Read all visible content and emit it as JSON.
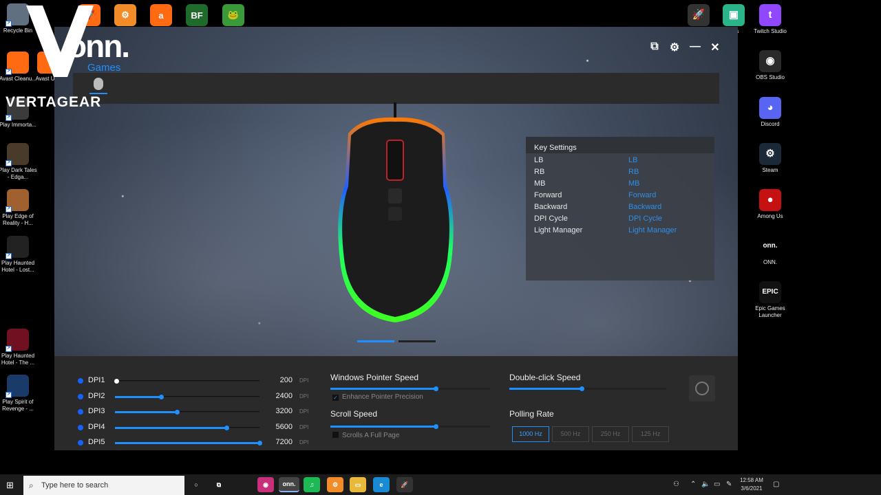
{
  "desktop": {
    "left_icons": [
      {
        "label": "Recycle Bin",
        "icon": "recycle-bin-icon",
        "color": "#607080"
      },
      {
        "label": "Avast Cleanu...",
        "icon": "rocket-icon",
        "color": "#ff6a13"
      },
      {
        "label": "Play Immorta...",
        "icon": "game-icon",
        "color": "#3b3b3b"
      },
      {
        "label": "Play Dark Tales - Edga...",
        "icon": "game-icon",
        "color": "#4a3a2a"
      },
      {
        "label": "Play Edge of Reality - H...",
        "icon": "dog-icon",
        "color": "#a06030"
      },
      {
        "label": "Play Haunted Hotel - Lost...",
        "icon": "xvi-icon",
        "color": "#222"
      },
      {
        "label": "Play Haunted Hotel - The ...",
        "icon": "game-icon",
        "color": "#701020"
      },
      {
        "label": "Play Spirit of Revenge - ...",
        "icon": "game-icon",
        "color": "#1a3a6a"
      }
    ],
    "second_column": [
      {
        "label": "Avast Upd",
        "icon": "avast-icon",
        "color": "#ff6a13"
      }
    ],
    "top_icons": [
      {
        "icon": "avast-cleanup-icon",
        "color": "#ff6a13",
        "glyph": "🚀"
      },
      {
        "icon": "avast-driver-icon",
        "color": "#f28c28",
        "glyph": "⚙"
      },
      {
        "icon": "avast-icon",
        "color": "#ff6a13",
        "glyph": "a"
      },
      {
        "icon": "big-fish-icon",
        "color": "#1f6b2c",
        "glyph": "BF"
      },
      {
        "icon": "fish-game-icon",
        "color": "#3a9a3a",
        "glyph": "🐸"
      }
    ],
    "right_icons": [
      {
        "label": "",
        "icon": "rocket-league-icon",
        "color": "#333",
        "glyph": "🚀"
      },
      {
        "label": "labs",
        "icon": "streamlabs-icon",
        "color": "#2bb38a",
        "glyph": "▣"
      },
      {
        "label": "Twitch Studio",
        "icon": "twitch-icon",
        "color": "#9146ff",
        "glyph": "t"
      },
      {
        "label": "OBS Studio",
        "icon": "obs-icon",
        "color": "#2a2a2a",
        "glyph": "◉"
      },
      {
        "label": "Discord",
        "icon": "discord-icon",
        "color": "#5865f2",
        "glyph": "◕"
      },
      {
        "label": "Steam",
        "icon": "steam-icon",
        "color": "#1b2838",
        "glyph": "⚙"
      },
      {
        "label": "Among Us",
        "icon": "among-us-icon",
        "color": "#c51111",
        "glyph": "●"
      },
      {
        "label": "ONN.",
        "icon": "onn-icon",
        "color": "#000",
        "glyph": "onn."
      },
      {
        "label": "Epic Games Launcher",
        "icon": "epic-games-icon",
        "color": "#111",
        "glyph": "EPIC"
      }
    ]
  },
  "overlay": {
    "brand": "onn.",
    "sub": "Games",
    "vertagear": "VERTAGEAR"
  },
  "app": {
    "key_settings": {
      "title": "Key Settings",
      "rows": [
        {
          "key": "LB",
          "value": "LB"
        },
        {
          "key": "RB",
          "value": "RB"
        },
        {
          "key": "MB",
          "value": "MB"
        },
        {
          "key": "Forward",
          "value": "Forward"
        },
        {
          "key": "Backward",
          "value": "Backward"
        },
        {
          "key": "DPI Cycle",
          "value": "DPI Cycle"
        },
        {
          "key": "Light Manager",
          "value": "Light Manager"
        }
      ]
    },
    "dpi": [
      {
        "label": "DPI1",
        "value": "200",
        "unit": "DPI",
        "level": 0.01
      },
      {
        "label": "DPI2",
        "value": "2400",
        "unit": "DPI",
        "level": 0.32
      },
      {
        "label": "DPI3",
        "value": "3200",
        "unit": "DPI",
        "level": 0.43
      },
      {
        "label": "DPI4",
        "value": "5600",
        "unit": "DPI",
        "level": 0.77
      },
      {
        "label": "DPI5",
        "value": "7200",
        "unit": "DPI",
        "level": 1.0
      }
    ],
    "pointer_speed": {
      "title": "Windows Pointer Speed",
      "level": 0.66,
      "option": "Enhance Pointer Precision",
      "checked": true
    },
    "scroll_speed": {
      "title": "Scroll Speed",
      "level": 0.66,
      "option": "Scrolls A Full Page",
      "checked": false
    },
    "double_click": {
      "title": "Double-click Speed",
      "level": 0.46
    },
    "polling": {
      "title": "Polling Rate",
      "options": [
        "1000 Hz",
        "500 Hz",
        "250 Hz",
        "125 Hz"
      ],
      "selected": "1000 Hz"
    },
    "accent": "#1e90ff"
  },
  "taskbar": {
    "search_placeholder": "Type here to search",
    "time": "12:58 AM",
    "date": "3/6/2021",
    "apps": [
      {
        "icon": "cortana-icon",
        "glyph": "○",
        "color": "transparent"
      },
      {
        "icon": "task-view-icon",
        "glyph": "⧉",
        "color": "transparent"
      },
      {
        "icon": "blank-app-icon",
        "glyph": "",
        "color": "transparent"
      },
      {
        "icon": "color-app-icon",
        "glyph": "◉",
        "color": "#c8307a"
      },
      {
        "icon": "onn-app-icon",
        "glyph": "onn.",
        "color": "#444"
      },
      {
        "icon": "spotify-icon",
        "glyph": "♫",
        "color": "#1db954"
      },
      {
        "icon": "avast-taskbar-icon",
        "glyph": "⚙",
        "color": "#f28c28"
      },
      {
        "icon": "file-explorer-icon",
        "glyph": "▭",
        "color": "#e8b83a"
      },
      {
        "icon": "edge-icon",
        "glyph": "e",
        "color": "#1a8ad4"
      },
      {
        "icon": "rocket-taskbar-icon",
        "glyph": "🚀",
        "color": "#333"
      }
    ]
  }
}
